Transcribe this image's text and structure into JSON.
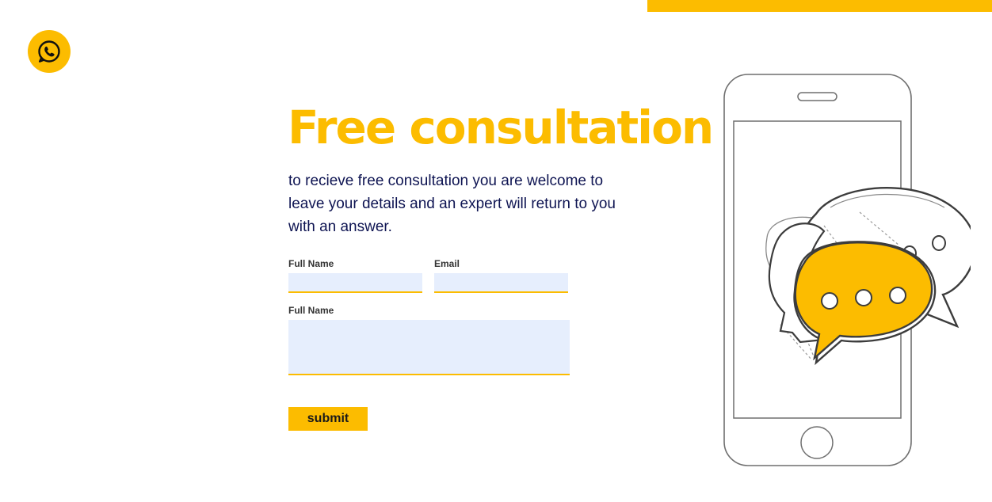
{
  "colors": {
    "accent": "#FCBC00",
    "heading_text": "#0E1452",
    "input_background": "#E6EEFD",
    "background": "#FFFFFF"
  },
  "header": {
    "contact_icon": "whatsapp-icon"
  },
  "hero": {
    "title": "Free consultation",
    "description": "to recieve free consultation you are welcome to leave your details and an expert will return to you with an answer."
  },
  "form": {
    "full_name_label": "Full Name",
    "full_name_value": "",
    "email_label": "Email",
    "email_value": "",
    "message_label": "Full Name",
    "message_value": "",
    "submit_label": "submit"
  },
  "illustration": {
    "icon": "phone-chat-illustration"
  }
}
